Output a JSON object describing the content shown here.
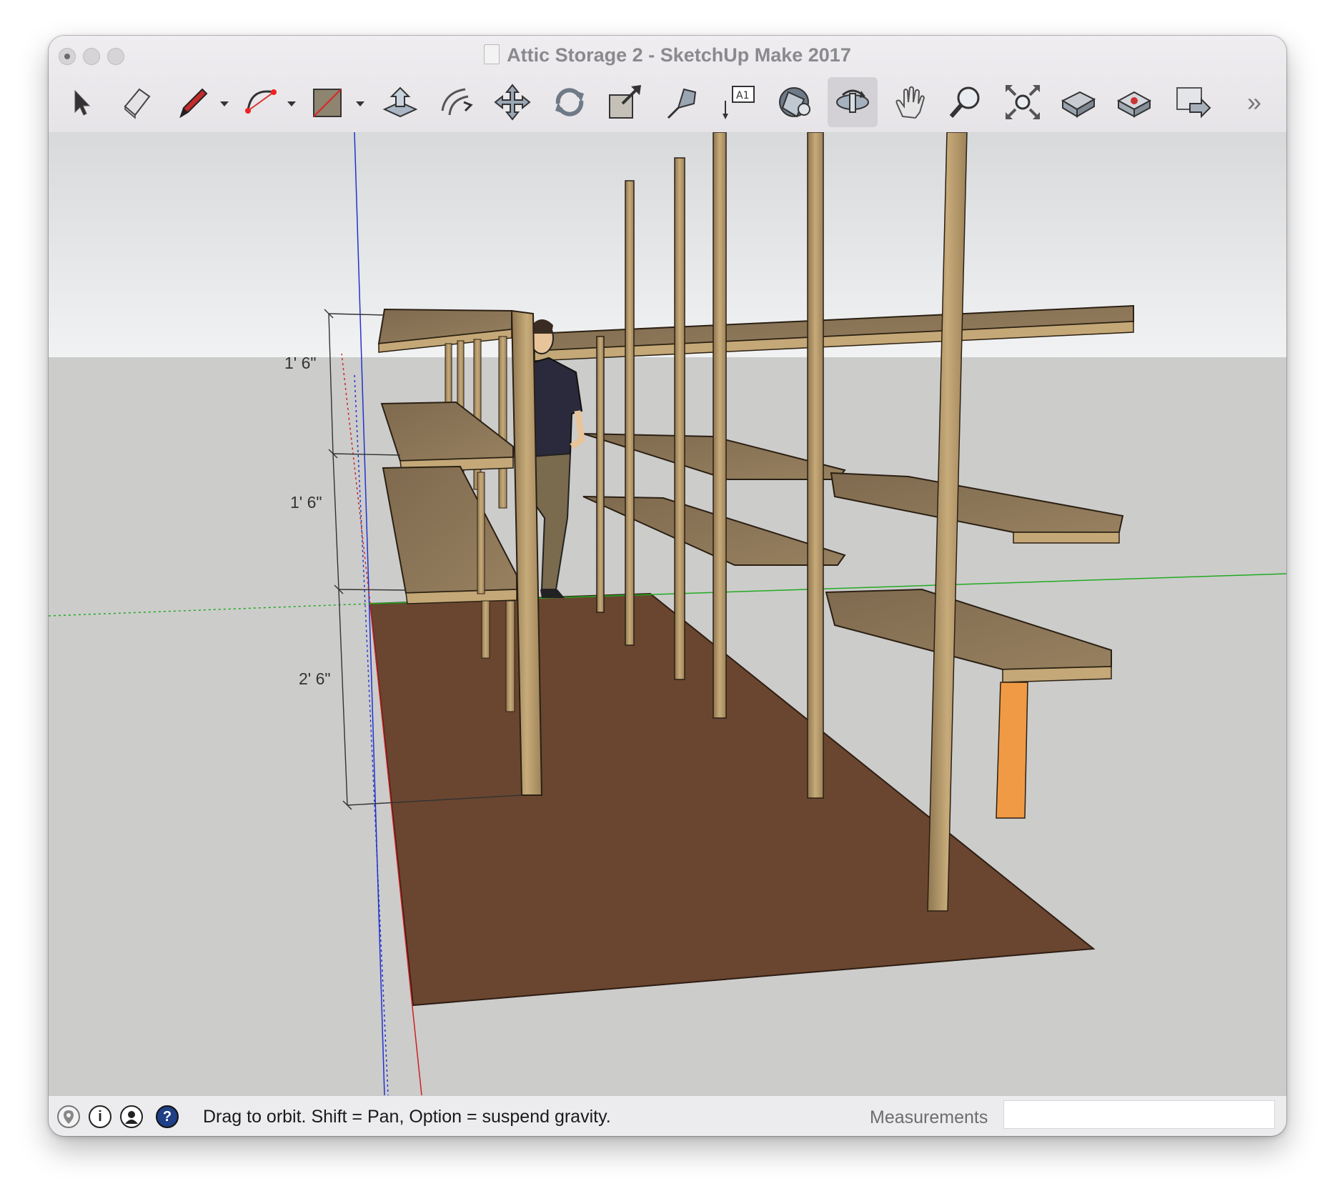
{
  "window": {
    "title": "Attic Storage 2 - SketchUp Make 2017"
  },
  "toolbar": {
    "tools": [
      {
        "name": "select-tool",
        "icon": "arrow-cursor-icon",
        "active": false
      },
      {
        "name": "eraser-tool",
        "icon": "eraser-icon",
        "active": false
      },
      {
        "name": "line-tool",
        "icon": "pencil-icon",
        "active": false,
        "dropdown": true
      },
      {
        "name": "arc-tool",
        "icon": "arc-icon",
        "active": false,
        "dropdown": true
      },
      {
        "name": "rectangle-tool",
        "icon": "rectangle-icon",
        "active": false,
        "dropdown": true
      },
      {
        "name": "push-pull-tool",
        "icon": "push-pull-icon",
        "active": false
      },
      {
        "name": "offset-tool",
        "icon": "offset-icon",
        "active": false
      },
      {
        "name": "move-tool",
        "icon": "move-arrows-icon",
        "active": false
      },
      {
        "name": "rotate-tool",
        "icon": "rotate-icon",
        "active": false
      },
      {
        "name": "scale-tool",
        "icon": "scale-icon",
        "active": false
      },
      {
        "name": "tape-measure-tool",
        "icon": "tape-measure-icon",
        "active": false
      },
      {
        "name": "text-tool",
        "icon": "text-label-icon",
        "active": false
      },
      {
        "name": "paint-bucket-tool",
        "icon": "paint-bucket-icon",
        "active": false
      },
      {
        "name": "orbit-tool",
        "icon": "orbit-icon",
        "active": true
      },
      {
        "name": "pan-tool",
        "icon": "hand-icon",
        "active": false
      },
      {
        "name": "zoom-tool",
        "icon": "magnifier-icon",
        "active": false
      },
      {
        "name": "zoom-extents-tool",
        "icon": "zoom-extents-icon",
        "active": false
      },
      {
        "name": "3d-warehouse-tool",
        "icon": "warehouse-icon",
        "active": false
      },
      {
        "name": "extension-warehouse-tool",
        "icon": "extension-warehouse-icon",
        "active": false
      },
      {
        "name": "send-to-layout-tool",
        "icon": "layout-icon",
        "active": false
      }
    ],
    "overflow_glyph": "»"
  },
  "viewport": {
    "dimensions": [
      {
        "label": "1' 6\""
      },
      {
        "label": "1' 6\""
      },
      {
        "label": "2' 6\""
      }
    ],
    "colors": {
      "sky": "#e6e7e8",
      "ground": "#cccccb",
      "floor": "#6a4630",
      "wood": "#b79a6c",
      "shelf_top": "#8c7558",
      "red_axis": "#cc2222",
      "green_axis": "#22aa22",
      "blue_axis": "#2233cc",
      "orange_block": "#f09a45",
      "person_shirt": "#2a2a3c",
      "person_pants": "#7a6a4e"
    }
  },
  "statusbar": {
    "icons": [
      "geo-location-icon",
      "info-icon",
      "user-account-icon",
      "help-icon"
    ],
    "message": "Drag to orbit.  Shift = Pan, Option = suspend gravity.",
    "measurements_label": "Measurements",
    "measurements_value": ""
  }
}
